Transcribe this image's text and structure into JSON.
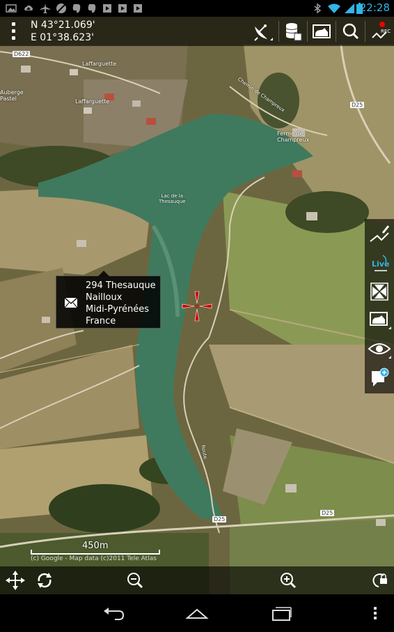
{
  "status_bar": {
    "time": "22:28",
    "notification_icons": [
      "image-icon",
      "cloud-upload-icon",
      "airplane-icon",
      "disabled-icon",
      "evernote-icon",
      "evernote-icon",
      "play-store-icon",
      "play-store-icon",
      "play-store-icon"
    ],
    "system_icons": [
      "bluetooth-off-icon",
      "wifi-icon",
      "signal-icon",
      "battery-icon"
    ]
  },
  "top_bar": {
    "coordinates": {
      "lat": "N 43°21.069'",
      "lon": "E 01°38.623'"
    },
    "buttons": [
      "satellite-dish-icon",
      "database-icon",
      "map-icon",
      "search-icon",
      "record-track-icon"
    ]
  },
  "side_panel": {
    "buttons": [
      "draw-route-icon",
      "live-tracking-icon",
      "center-gps-icon",
      "map-layers-icon",
      "visibility-icon",
      "add-point-icon"
    ]
  },
  "popup": {
    "lines": [
      "294 Thesauque",
      "Nailloux",
      "Midi-Pyrénées",
      "France"
    ],
    "icon": "mail-icon"
  },
  "map": {
    "labels": {
      "lake": "Lac de la\nThesauque",
      "laffarguette1": "Laffarguette",
      "laffarguette2": "Laffarguette",
      "auberge": "Auberge\nPastel",
      "ferme": "Ferme de\nChampreux",
      "chemin": "Chemin de Champreux",
      "rue": "Route"
    },
    "road_badges": [
      "D622",
      "D25",
      "D25",
      "D25"
    ],
    "scale_label": "450m",
    "attribution": "(c) Google - Map data (c)2011 Tele Atlas"
  },
  "bottom_bar": {
    "buttons": [
      "move-icon",
      "rotate-icon",
      "zoom-out-icon",
      "zoom-in-icon",
      "lock-rotation-icon"
    ]
  },
  "nav_bar": {
    "buttons": [
      "back-icon",
      "home-icon",
      "recent-apps-icon",
      "overflow-menu-icon"
    ]
  },
  "colors": {
    "accent": "#33b5e5",
    "crosshair": "#d40000",
    "lake": "#3f7a5e"
  }
}
